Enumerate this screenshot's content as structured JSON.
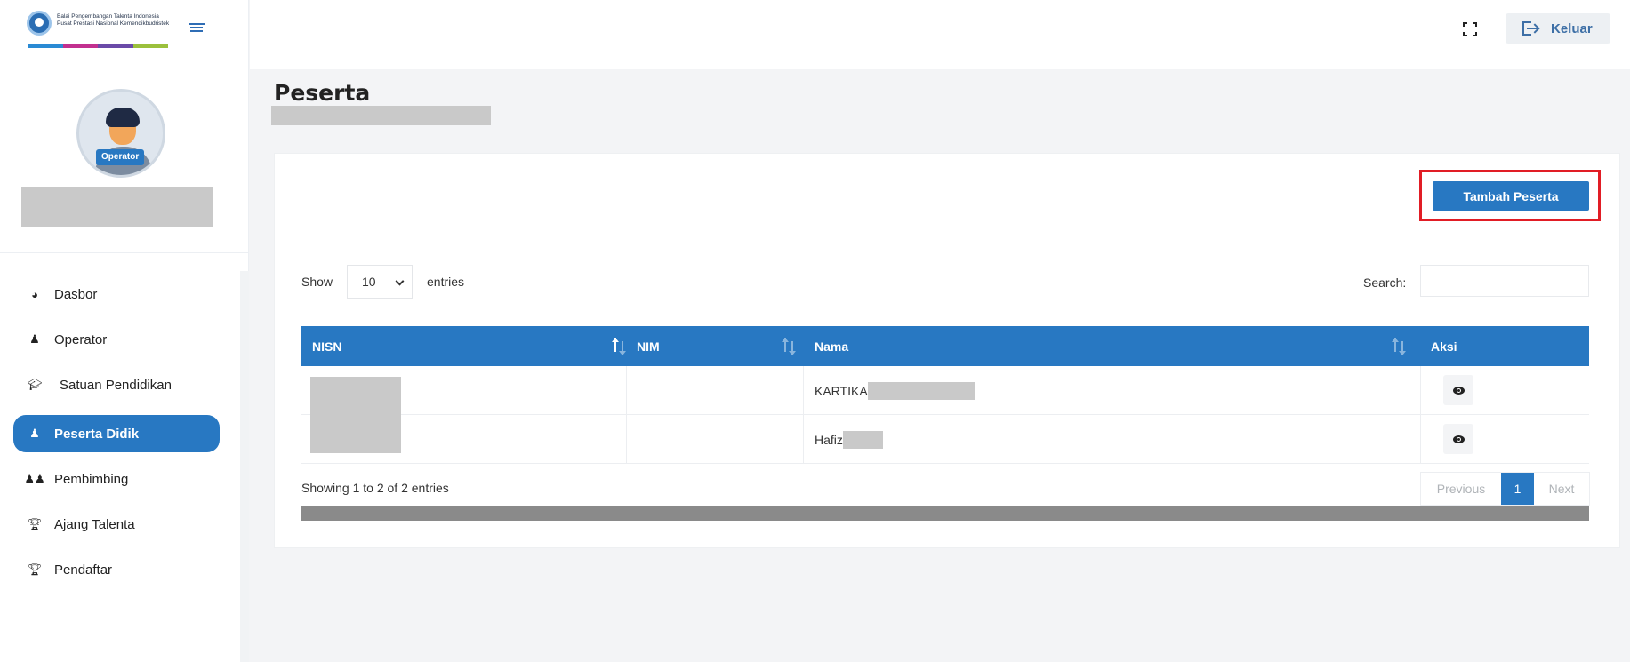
{
  "brand": {
    "logo_text": "Balai Pengembangan Talenta Indonesia Pusat Prestasi Nasional Kemendikbudristek",
    "colors": [
      "#2a8ad4",
      "#c2308f",
      "#6b4aa8",
      "#9bc03c"
    ]
  },
  "user": {
    "role": "Operator"
  },
  "sidebar": {
    "items": [
      {
        "label": "Dasbor",
        "icon": "dashboard-icon"
      },
      {
        "label": "Operator",
        "icon": "user-icon"
      },
      {
        "label": "Satuan Pendidikan",
        "icon": "graduation-cap-icon"
      },
      {
        "label": "Peserta Didik",
        "icon": "user-icon",
        "active": true
      },
      {
        "label": "Pembimbing",
        "icon": "users-icon"
      },
      {
        "label": "Ajang Talenta",
        "icon": "trophy-icon"
      },
      {
        "label": "Pendaftar",
        "icon": "trophy-icon"
      }
    ]
  },
  "header": {
    "logout_label": "Keluar",
    "fullscreen_icon": "fullscreen-icon"
  },
  "page": {
    "title": "Peserta",
    "add_button": "Tambah Peserta"
  },
  "table_controls": {
    "show_label": "Show",
    "entries_value": "10",
    "entries_label": "entries",
    "search_label": "Search:"
  },
  "table": {
    "columns": [
      "NISN",
      "NIM",
      "Nama",
      "Aksi"
    ],
    "rows": [
      {
        "nisn": "",
        "nim": "",
        "nama": "KARTIKA"
      },
      {
        "nisn": "",
        "nim": "",
        "nama": "Hafiz"
      }
    ],
    "info": "Showing 1 to 2 of 2 entries"
  },
  "pagination": {
    "previous": "Previous",
    "current": "1",
    "next": "Next"
  },
  "theme": {
    "accent": "#2878c2",
    "highlight": "#e11d25"
  }
}
